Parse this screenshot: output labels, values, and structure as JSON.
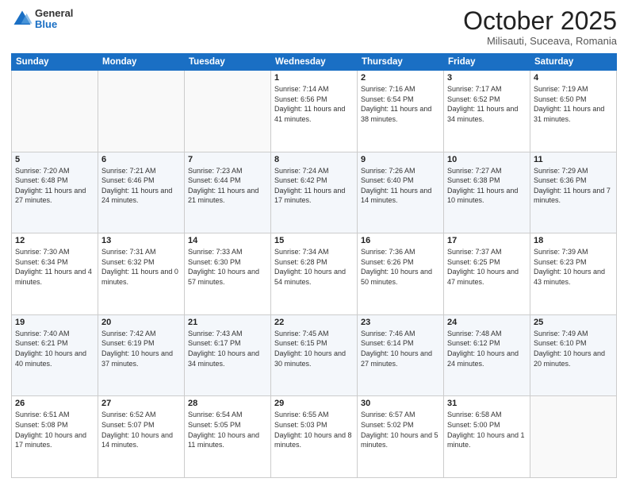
{
  "header": {
    "logo": {
      "general": "General",
      "blue": "Blue"
    },
    "title": "October 2025",
    "location": "Milisauti, Suceava, Romania"
  },
  "calendar": {
    "days_of_week": [
      "Sunday",
      "Monday",
      "Tuesday",
      "Wednesday",
      "Thursday",
      "Friday",
      "Saturday"
    ],
    "weeks": [
      [
        {
          "day": "",
          "sunrise": "",
          "sunset": "",
          "daylight": ""
        },
        {
          "day": "",
          "sunrise": "",
          "sunset": "",
          "daylight": ""
        },
        {
          "day": "",
          "sunrise": "",
          "sunset": "",
          "daylight": ""
        },
        {
          "day": "1",
          "sunrise": "Sunrise: 7:14 AM",
          "sunset": "Sunset: 6:56 PM",
          "daylight": "Daylight: 11 hours and 41 minutes."
        },
        {
          "day": "2",
          "sunrise": "Sunrise: 7:16 AM",
          "sunset": "Sunset: 6:54 PM",
          "daylight": "Daylight: 11 hours and 38 minutes."
        },
        {
          "day": "3",
          "sunrise": "Sunrise: 7:17 AM",
          "sunset": "Sunset: 6:52 PM",
          "daylight": "Daylight: 11 hours and 34 minutes."
        },
        {
          "day": "4",
          "sunrise": "Sunrise: 7:19 AM",
          "sunset": "Sunset: 6:50 PM",
          "daylight": "Daylight: 11 hours and 31 minutes."
        }
      ],
      [
        {
          "day": "5",
          "sunrise": "Sunrise: 7:20 AM",
          "sunset": "Sunset: 6:48 PM",
          "daylight": "Daylight: 11 hours and 27 minutes."
        },
        {
          "day": "6",
          "sunrise": "Sunrise: 7:21 AM",
          "sunset": "Sunset: 6:46 PM",
          "daylight": "Daylight: 11 hours and 24 minutes."
        },
        {
          "day": "7",
          "sunrise": "Sunrise: 7:23 AM",
          "sunset": "Sunset: 6:44 PM",
          "daylight": "Daylight: 11 hours and 21 minutes."
        },
        {
          "day": "8",
          "sunrise": "Sunrise: 7:24 AM",
          "sunset": "Sunset: 6:42 PM",
          "daylight": "Daylight: 11 hours and 17 minutes."
        },
        {
          "day": "9",
          "sunrise": "Sunrise: 7:26 AM",
          "sunset": "Sunset: 6:40 PM",
          "daylight": "Daylight: 11 hours and 14 minutes."
        },
        {
          "day": "10",
          "sunrise": "Sunrise: 7:27 AM",
          "sunset": "Sunset: 6:38 PM",
          "daylight": "Daylight: 11 hours and 10 minutes."
        },
        {
          "day": "11",
          "sunrise": "Sunrise: 7:29 AM",
          "sunset": "Sunset: 6:36 PM",
          "daylight": "Daylight: 11 hours and 7 minutes."
        }
      ],
      [
        {
          "day": "12",
          "sunrise": "Sunrise: 7:30 AM",
          "sunset": "Sunset: 6:34 PM",
          "daylight": "Daylight: 11 hours and 4 minutes."
        },
        {
          "day": "13",
          "sunrise": "Sunrise: 7:31 AM",
          "sunset": "Sunset: 6:32 PM",
          "daylight": "Daylight: 11 hours and 0 minutes."
        },
        {
          "day": "14",
          "sunrise": "Sunrise: 7:33 AM",
          "sunset": "Sunset: 6:30 PM",
          "daylight": "Daylight: 10 hours and 57 minutes."
        },
        {
          "day": "15",
          "sunrise": "Sunrise: 7:34 AM",
          "sunset": "Sunset: 6:28 PM",
          "daylight": "Daylight: 10 hours and 54 minutes."
        },
        {
          "day": "16",
          "sunrise": "Sunrise: 7:36 AM",
          "sunset": "Sunset: 6:26 PM",
          "daylight": "Daylight: 10 hours and 50 minutes."
        },
        {
          "day": "17",
          "sunrise": "Sunrise: 7:37 AM",
          "sunset": "Sunset: 6:25 PM",
          "daylight": "Daylight: 10 hours and 47 minutes."
        },
        {
          "day": "18",
          "sunrise": "Sunrise: 7:39 AM",
          "sunset": "Sunset: 6:23 PM",
          "daylight": "Daylight: 10 hours and 43 minutes."
        }
      ],
      [
        {
          "day": "19",
          "sunrise": "Sunrise: 7:40 AM",
          "sunset": "Sunset: 6:21 PM",
          "daylight": "Daylight: 10 hours and 40 minutes."
        },
        {
          "day": "20",
          "sunrise": "Sunrise: 7:42 AM",
          "sunset": "Sunset: 6:19 PM",
          "daylight": "Daylight: 10 hours and 37 minutes."
        },
        {
          "day": "21",
          "sunrise": "Sunrise: 7:43 AM",
          "sunset": "Sunset: 6:17 PM",
          "daylight": "Daylight: 10 hours and 34 minutes."
        },
        {
          "day": "22",
          "sunrise": "Sunrise: 7:45 AM",
          "sunset": "Sunset: 6:15 PM",
          "daylight": "Daylight: 10 hours and 30 minutes."
        },
        {
          "day": "23",
          "sunrise": "Sunrise: 7:46 AM",
          "sunset": "Sunset: 6:14 PM",
          "daylight": "Daylight: 10 hours and 27 minutes."
        },
        {
          "day": "24",
          "sunrise": "Sunrise: 7:48 AM",
          "sunset": "Sunset: 6:12 PM",
          "daylight": "Daylight: 10 hours and 24 minutes."
        },
        {
          "day": "25",
          "sunrise": "Sunrise: 7:49 AM",
          "sunset": "Sunset: 6:10 PM",
          "daylight": "Daylight: 10 hours and 20 minutes."
        }
      ],
      [
        {
          "day": "26",
          "sunrise": "Sunrise: 6:51 AM",
          "sunset": "Sunset: 5:08 PM",
          "daylight": "Daylight: 10 hours and 17 minutes."
        },
        {
          "day": "27",
          "sunrise": "Sunrise: 6:52 AM",
          "sunset": "Sunset: 5:07 PM",
          "daylight": "Daylight: 10 hours and 14 minutes."
        },
        {
          "day": "28",
          "sunrise": "Sunrise: 6:54 AM",
          "sunset": "Sunset: 5:05 PM",
          "daylight": "Daylight: 10 hours and 11 minutes."
        },
        {
          "day": "29",
          "sunrise": "Sunrise: 6:55 AM",
          "sunset": "Sunset: 5:03 PM",
          "daylight": "Daylight: 10 hours and 8 minutes."
        },
        {
          "day": "30",
          "sunrise": "Sunrise: 6:57 AM",
          "sunset": "Sunset: 5:02 PM",
          "daylight": "Daylight: 10 hours and 5 minutes."
        },
        {
          "day": "31",
          "sunrise": "Sunrise: 6:58 AM",
          "sunset": "Sunset: 5:00 PM",
          "daylight": "Daylight: 10 hours and 1 minute."
        },
        {
          "day": "",
          "sunrise": "",
          "sunset": "",
          "daylight": ""
        }
      ]
    ]
  }
}
